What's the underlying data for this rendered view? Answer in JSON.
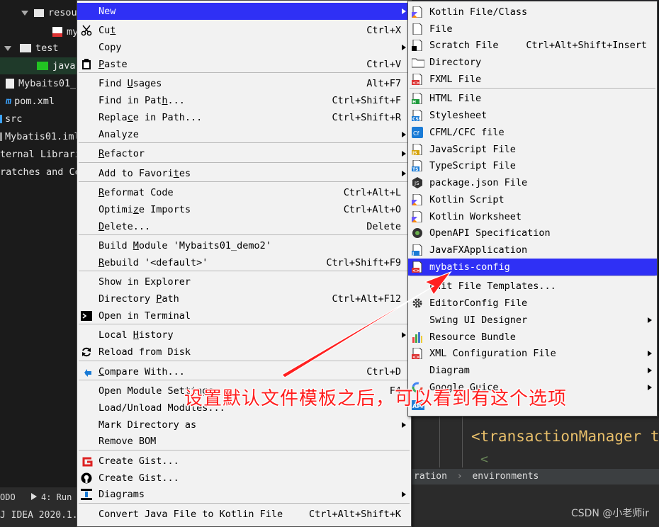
{
  "project_tree": {
    "items": [
      {
        "label": "resou",
        "kind": "folder"
      },
      {
        "label": "my",
        "kind": "xml"
      },
      {
        "label": "test",
        "kind": "folder"
      },
      {
        "label": "java",
        "kind": "folder-green"
      },
      {
        "label": "Mybaits01_",
        "kind": "file"
      },
      {
        "label": "pom.xml",
        "kind": "maven"
      },
      {
        "label": "src",
        "kind": "folder"
      },
      {
        "label": "Mybatis01.iml",
        "kind": "file"
      },
      {
        "label": "ternal Librari",
        "kind": "lib"
      },
      {
        "label": "ratches and Co",
        "kind": "scratch"
      }
    ]
  },
  "bottom_bar": {
    "todo": "ODO",
    "run": "4: Run",
    "ide_title": "J IDEA 2020.1."
  },
  "editor": {
    "code_line": "<transactionManager ty",
    "breadcrumb_1": "ration",
    "breadcrumb_sep": "›",
    "breadcrumb_2": "environments"
  },
  "context_menu": {
    "items": [
      {
        "label": "New",
        "shortcut": "",
        "submenu": true,
        "selected": true
      },
      {
        "label": "Cut",
        "shortcut": "Ctrl+X",
        "icon": "cut-icon"
      },
      {
        "label": "Copy",
        "shortcut": "",
        "submenu": true
      },
      {
        "label": "Paste",
        "shortcut": "Ctrl+V",
        "icon": "paste-icon"
      },
      {
        "label": "Find Usages",
        "shortcut": "Alt+F7"
      },
      {
        "label": "Find in Path...",
        "shortcut": "Ctrl+Shift+F"
      },
      {
        "label": "Replace in Path...",
        "shortcut": "Ctrl+Shift+R"
      },
      {
        "label": "Analyze",
        "shortcut": "",
        "submenu": true
      },
      {
        "label": "Refactor",
        "shortcut": "",
        "submenu": true
      },
      {
        "label": "Add to Favorites",
        "shortcut": "",
        "submenu": true
      },
      {
        "label": "Reformat Code",
        "shortcut": "Ctrl+Alt+L"
      },
      {
        "label": "Optimize Imports",
        "shortcut": "Ctrl+Alt+O"
      },
      {
        "label": "Delete...",
        "shortcut": "Delete"
      },
      {
        "label": "Build Module 'Mybaits01_demo2'",
        "shortcut": ""
      },
      {
        "label": "Rebuild '<default>'",
        "shortcut": "Ctrl+Shift+F9"
      },
      {
        "label": "Show in Explorer",
        "shortcut": ""
      },
      {
        "label": "Directory Path",
        "shortcut": "Ctrl+Alt+F12"
      },
      {
        "label": "Open in Terminal",
        "shortcut": "",
        "icon": "terminal-icon"
      },
      {
        "label": "Local History",
        "shortcut": "",
        "submenu": true
      },
      {
        "label": "Reload from Disk",
        "shortcut": "",
        "icon": "reload-icon"
      },
      {
        "label": "Compare With...",
        "shortcut": "Ctrl+D",
        "icon": "compare-icon"
      },
      {
        "label": "Open Module Settings",
        "shortcut": "F4"
      },
      {
        "label": "Load/Unload Modules...",
        "shortcut": ""
      },
      {
        "label": "Mark Directory as",
        "shortcut": "",
        "submenu": true
      },
      {
        "label": "Remove BOM",
        "shortcut": ""
      },
      {
        "label": "Create Gist...",
        "shortcut": "",
        "icon": "gist-icon"
      },
      {
        "label": "Create Gist...",
        "shortcut": "",
        "icon": "github-icon"
      },
      {
        "label": "Diagrams",
        "shortcut": "",
        "submenu": true,
        "icon": "diagram-icon"
      },
      {
        "label": "Convert Java File to Kotlin File",
        "shortcut": "Ctrl+Alt+Shift+K"
      }
    ]
  },
  "new_submenu": {
    "items": [
      {
        "label": "Kotlin File/Class",
        "icon": "kotlin-file-icon"
      },
      {
        "label": "File",
        "icon": "file-icon"
      },
      {
        "label": "Scratch File",
        "shortcut": "Ctrl+Alt+Shift+Insert",
        "icon": "scratch-file-icon"
      },
      {
        "label": "Directory",
        "icon": "folder-icon"
      },
      {
        "label": "FXML File",
        "icon": "fxml-icon"
      },
      {
        "label": "HTML File",
        "icon": "html-icon"
      },
      {
        "label": "Stylesheet",
        "icon": "css-icon"
      },
      {
        "label": "CFML/CFC file",
        "icon": "cfml-icon"
      },
      {
        "label": "JavaScript File",
        "icon": "javascript-icon"
      },
      {
        "label": "TypeScript File",
        "icon": "typescript-icon"
      },
      {
        "label": "package.json File",
        "icon": "nodejs-icon"
      },
      {
        "label": "Kotlin Script",
        "icon": "kotlin-script-icon"
      },
      {
        "label": "Kotlin Worksheet",
        "icon": "kotlin-worksheet-icon"
      },
      {
        "label": "OpenAPI Specification",
        "icon": "openapi-icon"
      },
      {
        "label": "JavaFXApplication",
        "icon": "javafx-icon"
      },
      {
        "label": "mybatis-config",
        "icon": "xml-template-icon",
        "selected": true
      },
      {
        "label": "Edit File Templates...",
        "icon": ""
      },
      {
        "label": "EditorConfig File",
        "icon": "gear-icon"
      },
      {
        "label": "Swing UI Designer",
        "icon": "",
        "submenu": true
      },
      {
        "label": "Resource Bundle",
        "icon": "resource-bundle-icon"
      },
      {
        "label": "XML Configuration File",
        "icon": "xml-config-icon",
        "submenu": true
      },
      {
        "label": "Diagram",
        "icon": "",
        "submenu": true
      },
      {
        "label": "Google Guice",
        "icon": "google-icon",
        "submenu": true
      },
      {
        "label": "API",
        "icon": "api-icon"
      }
    ]
  },
  "annotation": {
    "text": "设置默认文件模板之后，可以看到有这个选项",
    "color": "#ff1e1e"
  },
  "watermark": "CSDN @小老师ir",
  "colors": {
    "selection": "#2f30f5",
    "menu_bg": "#f2f2f2",
    "annotation": "#ff1e1e"
  }
}
